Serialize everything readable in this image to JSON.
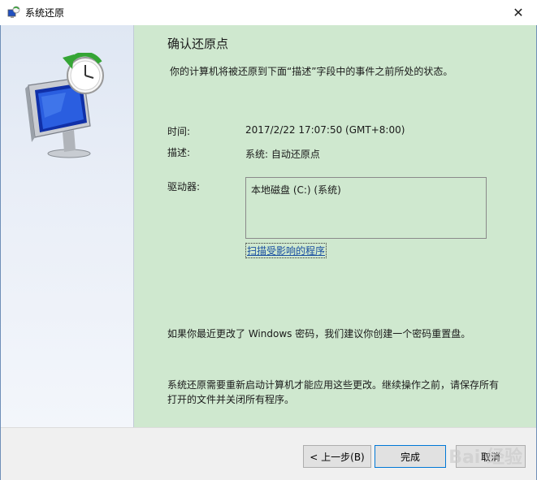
{
  "window": {
    "title": "系统还原",
    "close_glyph": "✕"
  },
  "main": {
    "heading": "确认还原点",
    "description": "你的计算机将被还原到下面“描述”字段中的事件之前所处的状态。",
    "time_label": "时间:",
    "time_value": "2017/2/22 17:07:50 (GMT+8:00)",
    "desc_label": "描述:",
    "desc_value": "系统: 自动还原点",
    "drives_label": "驱动器:",
    "drives": [
      "本地磁盘 (C:) (系统)"
    ],
    "scan_link": "扫描受影响的程序",
    "password_note": "如果你最近更改了 Windows 密码，我们建议你创建一个密码重置盘。",
    "restart_note_line1": "系统还原需要重新启动计算机才能应用这些更改。继续操作之前，请保存所有",
    "restart_note_line2": "打开的文件并关闭所有程序。"
  },
  "buttons": {
    "back": "< 上一步(B)",
    "finish": "完成",
    "cancel": "取消"
  },
  "watermark": "Bai 经验",
  "icons": {
    "title": "system-restore-icon",
    "sidebar": "system-restore-large-icon"
  }
}
